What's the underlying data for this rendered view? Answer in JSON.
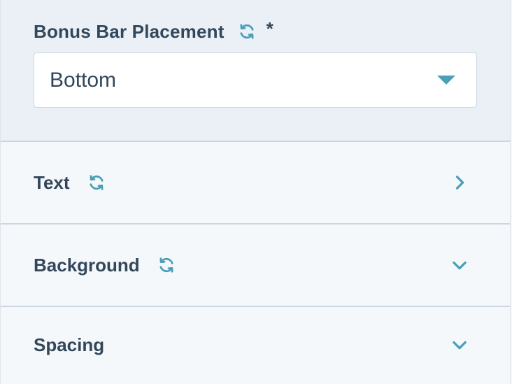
{
  "placement": {
    "label": "Bonus Bar Placement",
    "required_mark": "*",
    "selected_value": "Bottom"
  },
  "sections": [
    {
      "label": "Text",
      "has_sync_icon": true,
      "chevron": "chevron-right-icon"
    },
    {
      "label": "Background",
      "has_sync_icon": true,
      "chevron": "chevron-down-icon"
    },
    {
      "label": "Spacing",
      "has_sync_icon": false,
      "chevron": "chevron-down-icon"
    }
  ],
  "colors": {
    "accent": "#4b9fb6",
    "text": "#33475b",
    "header_bg": "#eaf0f6",
    "row_bg": "#f5f8fa",
    "border": "#cbd6e2"
  }
}
